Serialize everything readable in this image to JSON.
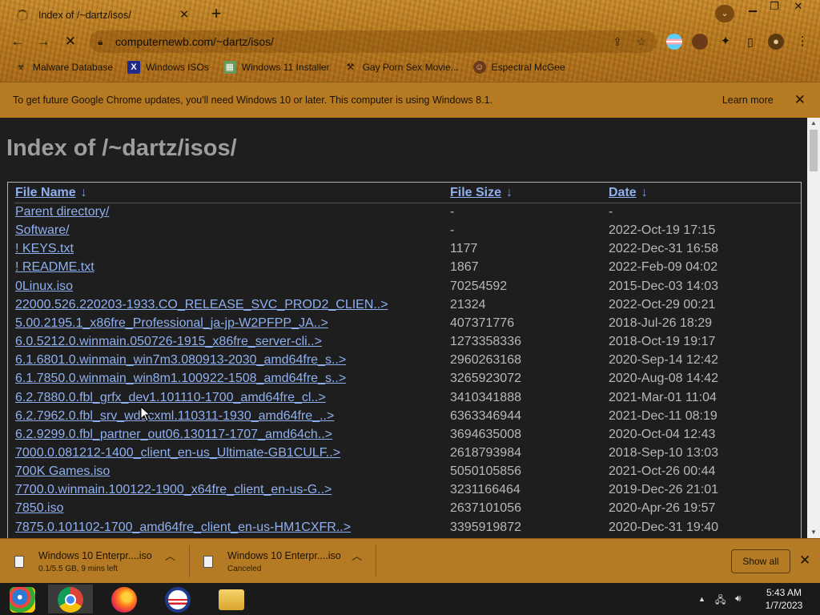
{
  "browser": {
    "tab_title": "Index of /~dartz/isos/",
    "url": "computernewb.com/~dartz/isos/",
    "bookmarks": [
      {
        "label": "Malware Database",
        "icon": "biohazard-icon"
      },
      {
        "label": "Windows ISOs",
        "icon": "x-icon"
      },
      {
        "label": "Windows 11 Installer",
        "icon": "image-icon"
      },
      {
        "label": "Gay Porn Sex Movie...",
        "icon": "hammer-icon"
      },
      {
        "label": "Espectral McGee",
        "icon": "avatar-icon"
      }
    ]
  },
  "infobar": {
    "message": "To get future Google Chrome updates, you'll need Windows 10 or later. This computer is using Windows 8.1.",
    "learn_more": "Learn more"
  },
  "page": {
    "title": "Index of /~dartz/isos/",
    "columns": {
      "name": "File Name",
      "size": "File Size",
      "date": "Date",
      "sort_glyph": "↓"
    },
    "rows": [
      {
        "name": "Parent directory/",
        "size": "-",
        "date": "-"
      },
      {
        "name": "Software/",
        "size": "-",
        "date": "2022-Oct-19 17:15"
      },
      {
        "name": "! KEYS.txt",
        "size": "1177",
        "date": "2022-Dec-31 16:58"
      },
      {
        "name": "! README.txt",
        "size": "1867",
        "date": "2022-Feb-09 04:02"
      },
      {
        "name": "0Linux.iso",
        "size": "70254592",
        "date": "2015-Dec-03 14:03"
      },
      {
        "name": "22000.526.220203-1933.CO_RELEASE_SVC_PROD2_CLIEN..>",
        "size": "21324",
        "date": "2022-Oct-29 00:21"
      },
      {
        "name": "5.00.2195.1_x86fre_Professional_ja-jp-W2PFPP_JA..>",
        "size": "407371776",
        "date": "2018-Jul-26 18:29"
      },
      {
        "name": "6.0.5212.0.winmain.050726-1915_x86fre_server-cli..>",
        "size": "1273358336",
        "date": "2018-Oct-19 19:17"
      },
      {
        "name": "6.1.6801.0.winmain_win7m3.080913-2030_amd64fre_s..>",
        "size": "2960263168",
        "date": "2020-Sep-14 12:42"
      },
      {
        "name": "6.1.7850.0.winmain_win8m1.100922-1508_amd64fre_s..>",
        "size": "3265923072",
        "date": "2020-Aug-08 14:42"
      },
      {
        "name": "6.2.7880.0.fbl_grfx_dev1.101110-1700_amd64fre_cl..>",
        "size": "3410341888",
        "date": "2021-Mar-01 11:04"
      },
      {
        "name": "6.2.7962.0.fbl_srv_wdacxml.110311-1930_amd64fre_..>",
        "size": "6363346944",
        "date": "2021-Dec-11 08:19"
      },
      {
        "name": "6.2.9299.0.fbl_partner_out06.130117-1707_amd64ch..>",
        "size": "3694635008",
        "date": "2020-Oct-04 12:43"
      },
      {
        "name": "7000.0.081212-1400_client_en-us_Ultimate-GB1CULF..>",
        "size": "2618793984",
        "date": "2018-Sep-10 13:03"
      },
      {
        "name": "700K Games.iso",
        "size": "5050105856",
        "date": "2021-Oct-26 00:44"
      },
      {
        "name": "7700.0.winmain.100122-1900_x64fre_client_en-us-G..>",
        "size": "3231166464",
        "date": "2019-Dec-26 21:01"
      },
      {
        "name": "7850.iso",
        "size": "2637101056",
        "date": "2020-Apr-26 19:57"
      },
      {
        "name": "7875.0.101102-1700_amd64fre_client_en-us-HM1CXFR..>",
        "size": "3395919872",
        "date": "2020-Dec-31 19:40"
      }
    ]
  },
  "downloads": {
    "items": [
      {
        "name": "Windows 10 Enterpr....iso",
        "status": "0.1/5.5 GB, 9 mins left"
      },
      {
        "name": "Windows 10 Enterpr....iso",
        "status": "Canceled"
      }
    ],
    "show_all": "Show all"
  },
  "taskbar": {
    "time": "5:43 AM",
    "date": "1/7/2023",
    "apps": [
      "windows-start-icon",
      "chrome-icon",
      "firefox-icon",
      "obama-icon",
      "file-explorer-icon"
    ]
  }
}
